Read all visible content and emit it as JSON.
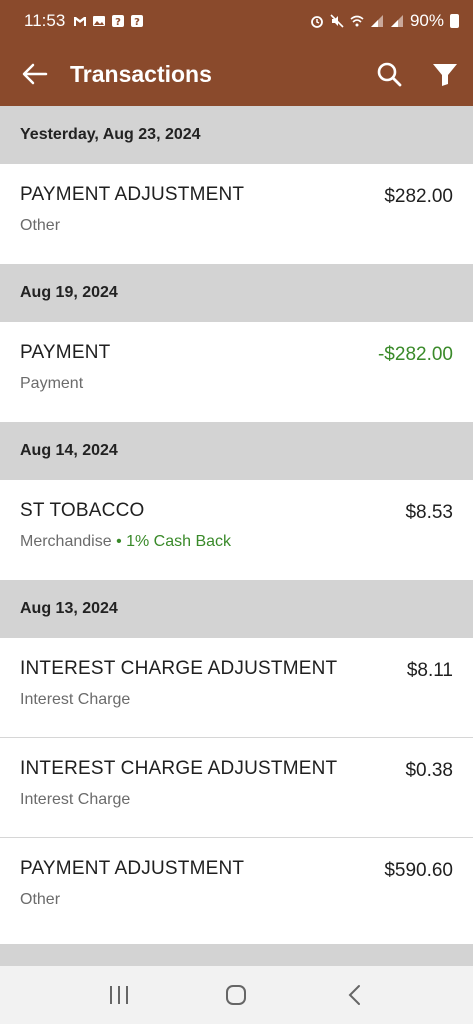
{
  "status_bar": {
    "time": "11:53",
    "battery": "90%",
    "icons": [
      "gmail-icon",
      "image-icon",
      "unknown-app-icon",
      "unknown-app-icon",
      "alarm-icon",
      "mute-icon",
      "wifi-icon",
      "signal-icon",
      "signal-icon",
      "battery-icon"
    ]
  },
  "app_bar": {
    "title": "Transactions",
    "accent_color": "#8a4a2c"
  },
  "groups": [
    {
      "date": "Yesterday, Aug 23, 2024",
      "transactions": [
        {
          "name": "PAYMENT ADJUSTMENT",
          "category": "Other",
          "amount": "$282.00"
        }
      ]
    },
    {
      "date": "Aug 19, 2024",
      "transactions": [
        {
          "name": "PAYMENT",
          "category": "Payment",
          "amount": "-$282.00"
        }
      ]
    },
    {
      "date": "Aug 14, 2024",
      "transactions": [
        {
          "name": "ST TOBACCO",
          "category": "Merchandise",
          "cashback": "• 1% Cash Back",
          "amount": "$8.53"
        }
      ]
    },
    {
      "date": "Aug 13, 2024",
      "transactions": [
        {
          "name": "INTEREST CHARGE ADJUSTMENT",
          "category": "Interest Charge",
          "amount": "$8.11"
        },
        {
          "name": "INTEREST CHARGE ADJUSTMENT",
          "category": "Interest Charge",
          "amount": "$0.38"
        },
        {
          "name": "PAYMENT ADJUSTMENT",
          "category": "Other",
          "amount": "$590.60"
        }
      ]
    }
  ],
  "colors": {
    "credit": "#3a8a2a",
    "header_bg": "#d3d3d3"
  }
}
